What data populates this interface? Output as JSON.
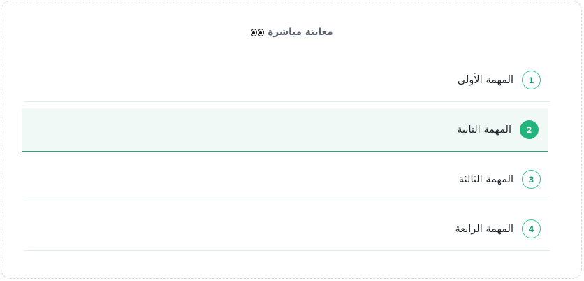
{
  "panel": {
    "title": "معاينة مباشرة",
    "title_icon": "eyes-icon"
  },
  "tasks": [
    {
      "number": "1",
      "label": "المهمة الأولى",
      "active": false
    },
    {
      "number": "2",
      "label": "المهمة الثانية",
      "active": true
    },
    {
      "number": "3",
      "label": "المهمة الثالثة",
      "active": false
    },
    {
      "number": "4",
      "label": "المهمة الرابعة",
      "active": false
    }
  ],
  "colors": {
    "accent": "#22b47d",
    "active_row_bg": "#f0f9f5",
    "divider": "#ddf1e8",
    "title_text": "#5b6370"
  }
}
